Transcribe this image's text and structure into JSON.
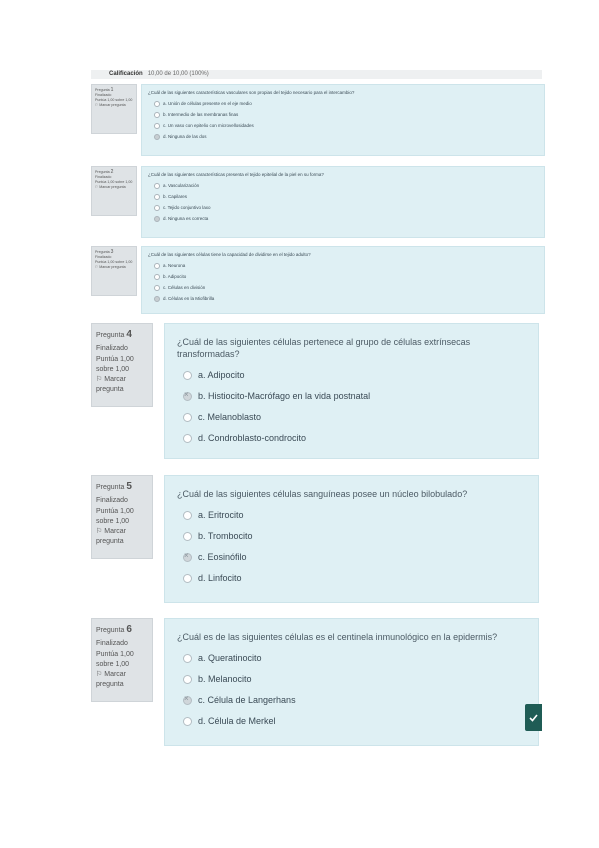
{
  "grade": {
    "label": "Calificación",
    "value": "10,00 de 10,00 (100%)"
  },
  "questions": [
    {
      "label": "Pregunta",
      "number": "1",
      "status": "Finalizado",
      "score": "Puntúa 1,00 sobre 1,00",
      "flag_label": "Marcar pregunta",
      "text": "¿Cuál de las siguientes características vasculares son propias del tejido necesario para el intercambio?",
      "options": [
        "a. Unión de células presente en el eje medio",
        "b. Intermedio de las membranas finas",
        "c. Un vaso con epitelio con microvellosidades",
        "d. Ninguna de las dos"
      ],
      "selected": 3
    },
    {
      "label": "Pregunta",
      "number": "2",
      "status": "Finalizado",
      "score": "Puntúa 1,00 sobre 1,00",
      "flag_label": "Marcar pregunta",
      "text": "¿Cuál de las siguientes características presenta el tejido epitelial de la piel en su forma?",
      "options": [
        "a. Vascularización",
        "b. Capilares",
        "c. Tejido conjuntivo laxo",
        "d. Ninguna es correcta"
      ],
      "selected": 3
    },
    {
      "label": "Pregunta",
      "number": "3",
      "status": "Finalizado",
      "score": "Puntúa 1,00 sobre 1,00",
      "flag_label": "Marcar pregunta",
      "text": "¿Cuál de las siguientes células tiene la capacidad de dividirse en el tejido adulto?",
      "options": [
        "a. Neurona",
        "b. Adipocito",
        "c. Células en división",
        "d. Células en la Miofibrilla"
      ],
      "selected": 3
    },
    {
      "label": "Pregunta",
      "number": "4",
      "status": "Finalizado",
      "score": "Puntúa 1,00 sobre 1,00",
      "flag_label": "Marcar pregunta",
      "text": "¿Cuál de las siguientes células pertenece al grupo de células extrínsecas transformadas?",
      "options": [
        "a. Adipocito",
        "b. Histiocito-Macrófago en la vida postnatal",
        "c. Melanoblasto",
        "d. Condroblasto-condrocito"
      ],
      "selected": 1
    },
    {
      "label": "Pregunta",
      "number": "5",
      "status": "Finalizado",
      "score": "Puntúa 1,00 sobre 1,00",
      "flag_label": "Marcar pregunta",
      "text": "¿Cuál de las siguientes células sanguíneas posee un núcleo bilobulado?",
      "options": [
        "a. Eritrocito",
        "b. Trombocito",
        "c. Eosinófilo",
        "d. Linfocito"
      ],
      "selected": 2
    },
    {
      "label": "Pregunta",
      "number": "6",
      "status": "Finalizado",
      "score": "Puntúa 1,00 sobre 1,00",
      "flag_label": "Marcar pregunta",
      "text": "¿Cuál es de las siguientes células es el centinela inmunológico en la epidermis?",
      "options": [
        "a. Queratinocito",
        "b. Melanocito",
        "c. Célula de Langerhans",
        "d. Célula de Merkel"
      ],
      "selected": 2
    }
  ],
  "icons": {
    "flag": "flag-icon",
    "side_button": "check-icon"
  },
  "colors": {
    "content_bg": "#dff0f4",
    "info_bg": "#dfe3e6",
    "side_button": "#1f5c55"
  }
}
